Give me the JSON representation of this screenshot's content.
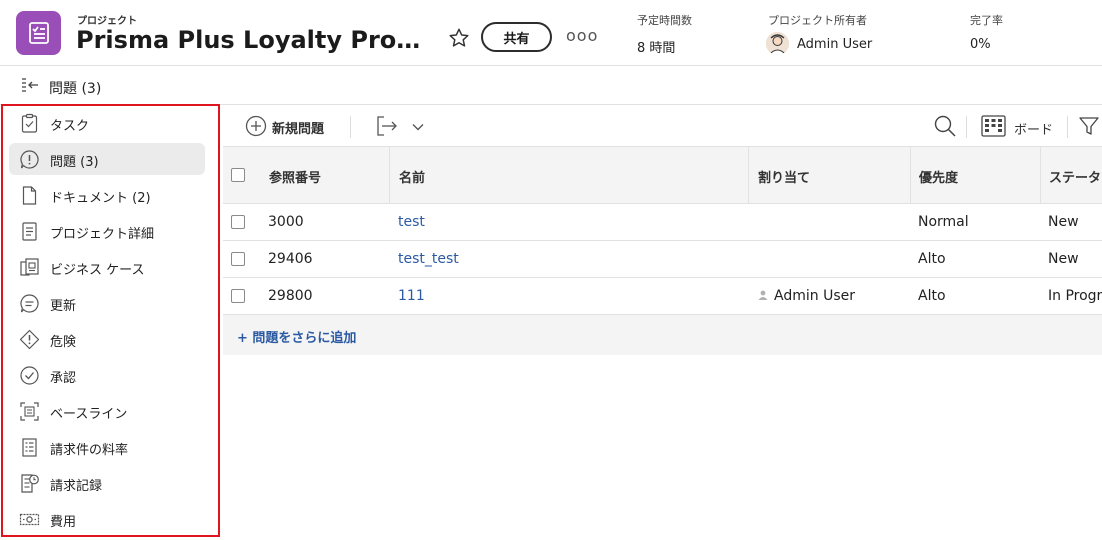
{
  "header": {
    "project_label": "プロジェクト",
    "project_title": "Prisma Plus Loyalty Program",
    "share_label": "共有",
    "more_label": "ooo",
    "planned_hours_label": "予定時間数",
    "planned_hours_value": "8 時間",
    "owner_label": "プロジェクト所有者",
    "owner_name": "Admin User",
    "completion_label": "完了率",
    "completion_value": "0%"
  },
  "subheader": {
    "title": "問題 (3)"
  },
  "sidebar": {
    "items": [
      {
        "label": "タスク",
        "icon": "task-icon"
      },
      {
        "label": "問題 (3)",
        "icon": "issue-icon",
        "active": true
      },
      {
        "label": "ドキュメント (2)",
        "icon": "document-icon"
      },
      {
        "label": "プロジェクト詳細",
        "icon": "details-icon"
      },
      {
        "label": "ビジネス ケース",
        "icon": "business-case-icon"
      },
      {
        "label": "更新",
        "icon": "updates-icon"
      },
      {
        "label": "危険",
        "icon": "risk-icon"
      },
      {
        "label": "承認",
        "icon": "approval-icon"
      },
      {
        "label": "ベースライン",
        "icon": "baseline-icon"
      },
      {
        "label": "請求件の料率",
        "icon": "billing-rates-icon"
      },
      {
        "label": "請求記録",
        "icon": "billing-records-icon"
      },
      {
        "label": "費用",
        "icon": "expenses-icon"
      }
    ]
  },
  "toolbar": {
    "new_issue_label": "新規問題",
    "board_label": "ボード"
  },
  "table": {
    "columns": [
      "参照番号",
      "名前",
      "割り当て",
      "優先度",
      "ステータス"
    ],
    "rows": [
      {
        "ref": "3000",
        "name": "test",
        "assigned": "",
        "priority": "Normal",
        "status": "New"
      },
      {
        "ref": "29406",
        "name": "test_test",
        "assigned": "",
        "priority": "Alto",
        "status": "New"
      },
      {
        "ref": "29800",
        "name": "111",
        "assigned": "Admin User",
        "priority": "Alto",
        "status": "In Progress"
      }
    ],
    "add_more_label": "+ 問題をさらに追加"
  },
  "colors": {
    "project_icon": "#9a4fb8",
    "link": "#2b5aa3",
    "highlight_outline": "#e0141e"
  }
}
